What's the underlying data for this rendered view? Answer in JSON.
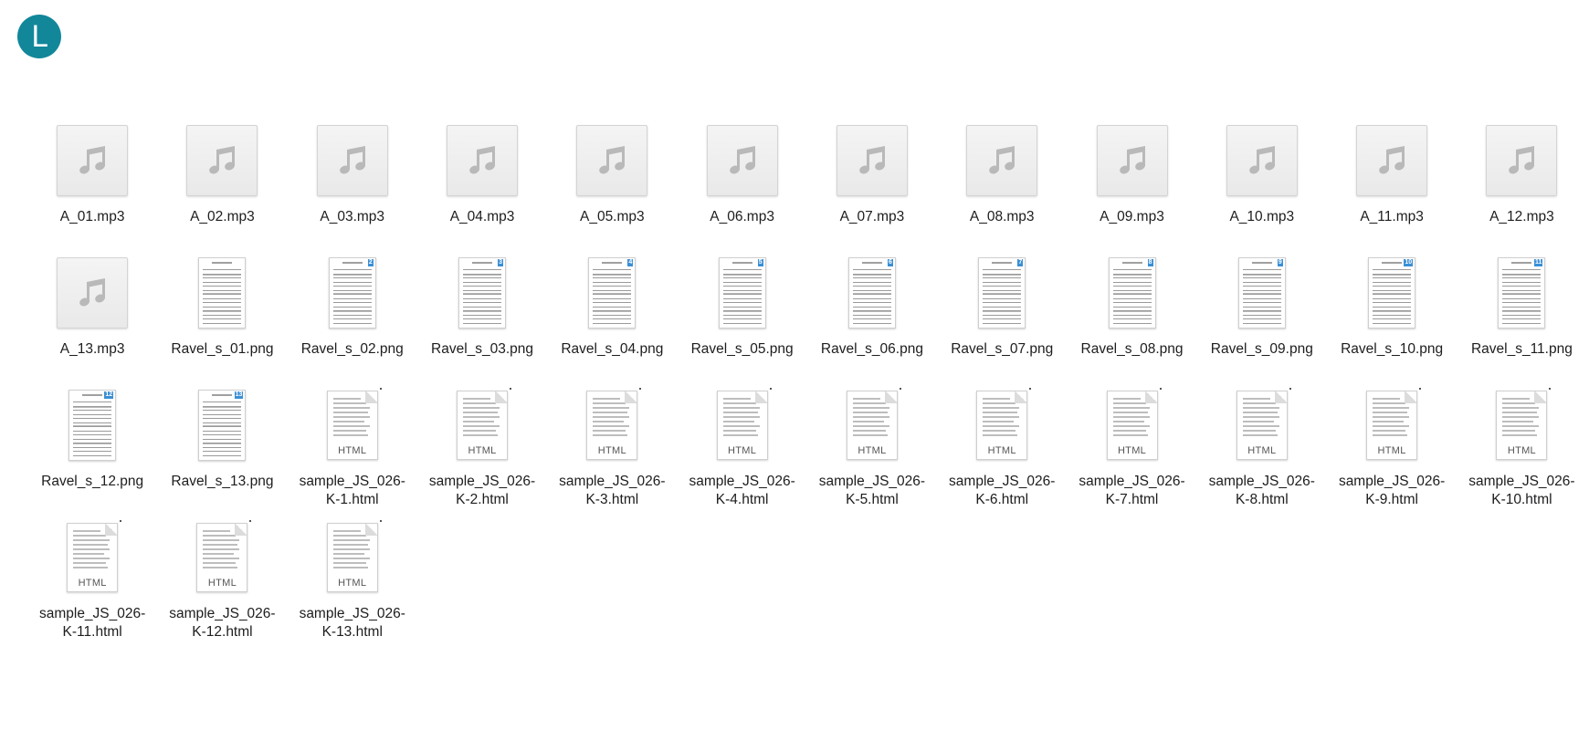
{
  "user": {
    "avatar_initial": "L"
  },
  "colors": {
    "avatar": "#12879a",
    "page_badge": "#3a8fd6"
  },
  "files": [
    {
      "name": "A_01.mp3",
      "kind": "audio",
      "icon": "music-note-icon"
    },
    {
      "name": "A_02.mp3",
      "kind": "audio",
      "icon": "music-note-icon"
    },
    {
      "name": "A_03.mp3",
      "kind": "audio",
      "icon": "music-note-icon"
    },
    {
      "name": "A_04.mp3",
      "kind": "audio",
      "icon": "music-note-icon"
    },
    {
      "name": "A_05.mp3",
      "kind": "audio",
      "icon": "music-note-icon"
    },
    {
      "name": "A_06.mp3",
      "kind": "audio",
      "icon": "music-note-icon"
    },
    {
      "name": "A_07.mp3",
      "kind": "audio",
      "icon": "music-note-icon"
    },
    {
      "name": "A_08.mp3",
      "kind": "audio",
      "icon": "music-note-icon"
    },
    {
      "name": "A_09.mp3",
      "kind": "audio",
      "icon": "music-note-icon"
    },
    {
      "name": "A_10.mp3",
      "kind": "audio",
      "icon": "music-note-icon"
    },
    {
      "name": "A_11.mp3",
      "kind": "audio",
      "icon": "music-note-icon"
    },
    {
      "name": "A_12.mp3",
      "kind": "audio",
      "icon": "music-note-icon"
    },
    {
      "name": "A_13.mp3",
      "kind": "audio",
      "icon": "music-note-icon"
    },
    {
      "name": "Ravel_s_01.png",
      "kind": "image",
      "icon": "sheet-music-thumbnail-icon",
      "page": ""
    },
    {
      "name": "Ravel_s_02.png",
      "kind": "image",
      "icon": "sheet-music-thumbnail-icon",
      "page": "2"
    },
    {
      "name": "Ravel_s_03.png",
      "kind": "image",
      "icon": "sheet-music-thumbnail-icon",
      "page": "3"
    },
    {
      "name": "Ravel_s_04.png",
      "kind": "image",
      "icon": "sheet-music-thumbnail-icon",
      "page": "4"
    },
    {
      "name": "Ravel_s_05.png",
      "kind": "image",
      "icon": "sheet-music-thumbnail-icon",
      "page": "5"
    },
    {
      "name": "Ravel_s_06.png",
      "kind": "image",
      "icon": "sheet-music-thumbnail-icon",
      "page": "6"
    },
    {
      "name": "Ravel_s_07.png",
      "kind": "image",
      "icon": "sheet-music-thumbnail-icon",
      "page": "7"
    },
    {
      "name": "Ravel_s_08.png",
      "kind": "image",
      "icon": "sheet-music-thumbnail-icon",
      "page": "8"
    },
    {
      "name": "Ravel_s_09.png",
      "kind": "image",
      "icon": "sheet-music-thumbnail-icon",
      "page": "9"
    },
    {
      "name": "Ravel_s_10.png",
      "kind": "image",
      "icon": "sheet-music-thumbnail-icon",
      "page": "10"
    },
    {
      "name": "Ravel_s_11.png",
      "kind": "image",
      "icon": "sheet-music-thumbnail-icon",
      "page": "11"
    },
    {
      "name": "Ravel_s_12.png",
      "kind": "image",
      "icon": "sheet-music-thumbnail-icon",
      "page": "12"
    },
    {
      "name": "Ravel_s_13.png",
      "kind": "image",
      "icon": "sheet-music-thumbnail-icon",
      "page": "13"
    },
    {
      "name": "sample_JS_026-K-1.html",
      "kind": "html",
      "icon": "html-document-icon",
      "badge": "HTML"
    },
    {
      "name": "sample_JS_026-K-2.html",
      "kind": "html",
      "icon": "html-document-icon",
      "badge": "HTML"
    },
    {
      "name": "sample_JS_026-K-3.html",
      "kind": "html",
      "icon": "html-document-icon",
      "badge": "HTML"
    },
    {
      "name": "sample_JS_026-K-4.html",
      "kind": "html",
      "icon": "html-document-icon",
      "badge": "HTML"
    },
    {
      "name": "sample_JS_026-K-5.html",
      "kind": "html",
      "icon": "html-document-icon",
      "badge": "HTML"
    },
    {
      "name": "sample_JS_026-K-6.html",
      "kind": "html",
      "icon": "html-document-icon",
      "badge": "HTML"
    },
    {
      "name": "sample_JS_026-K-7.html",
      "kind": "html",
      "icon": "html-document-icon",
      "badge": "HTML"
    },
    {
      "name": "sample_JS_026-K-8.html",
      "kind": "html",
      "icon": "html-document-icon",
      "badge": "HTML"
    },
    {
      "name": "sample_JS_026-K-9.html",
      "kind": "html",
      "icon": "html-document-icon",
      "badge": "HTML"
    },
    {
      "name": "sample_JS_026-K-10.html",
      "kind": "html",
      "icon": "html-document-icon",
      "badge": "HTML"
    },
    {
      "name": "sample_JS_026-K-11.html",
      "kind": "html",
      "icon": "html-document-icon",
      "badge": "HTML"
    },
    {
      "name": "sample_JS_026-K-12.html",
      "kind": "html",
      "icon": "html-document-icon",
      "badge": "HTML"
    },
    {
      "name": "sample_JS_026-K-13.html",
      "kind": "html",
      "icon": "html-document-icon",
      "badge": "HTML"
    }
  ]
}
